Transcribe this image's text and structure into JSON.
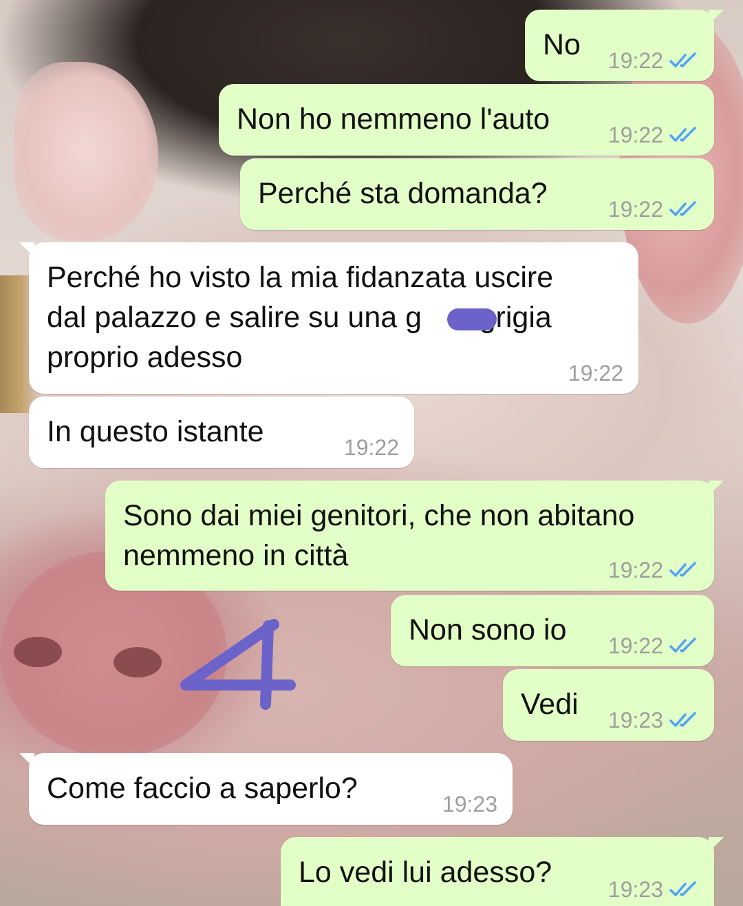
{
  "chat": {
    "messages": [
      {
        "dir": "out",
        "text": "No",
        "time": "19:22",
        "status": "read-double-check"
      },
      {
        "dir": "out",
        "text": "Non ho nemmeno l'auto",
        "time": "19:22",
        "status": "read-double-check"
      },
      {
        "dir": "out",
        "text": "Perché sta domanda?",
        "time": "19:22",
        "status": "read-double-check"
      },
      {
        "dir": "in",
        "text": "Perché ho visto la mia fidanzata uscire\ndal palazzo e salire su una g       grigia\nproprio adesso",
        "time": "19:22"
      },
      {
        "dir": "in",
        "text": "In questo istante",
        "time": "19:22"
      },
      {
        "dir": "out",
        "text": "Sono dai miei genitori, che non abitano\nnemmeno in città",
        "time": "19:22",
        "status": "read-double-check"
      },
      {
        "dir": "out",
        "text": "Non sono io",
        "time": "19:22",
        "status": "read-double-check"
      },
      {
        "dir": "out",
        "text": "Vedi",
        "time": "19:23",
        "status": "read-double-check"
      },
      {
        "dir": "in",
        "text": "Come faccio a saperlo?",
        "time": "19:23"
      },
      {
        "dir": "out",
        "text": "Lo vedi lui adesso?",
        "time": "19:23",
        "status": "read-double-check"
      }
    ]
  },
  "overlay": {
    "annotation_number": "4",
    "annotation_color": "#6b63c9",
    "redaction_color": "#6b63c9"
  },
  "colors": {
    "outgoing_bubble": "#e2ffc7",
    "incoming_bubble": "#ffffff",
    "read_ticks": "#4fa3f7",
    "timestamp": "#9e9e9e"
  },
  "icons": {
    "read_receipt": "double-check-icon"
  }
}
